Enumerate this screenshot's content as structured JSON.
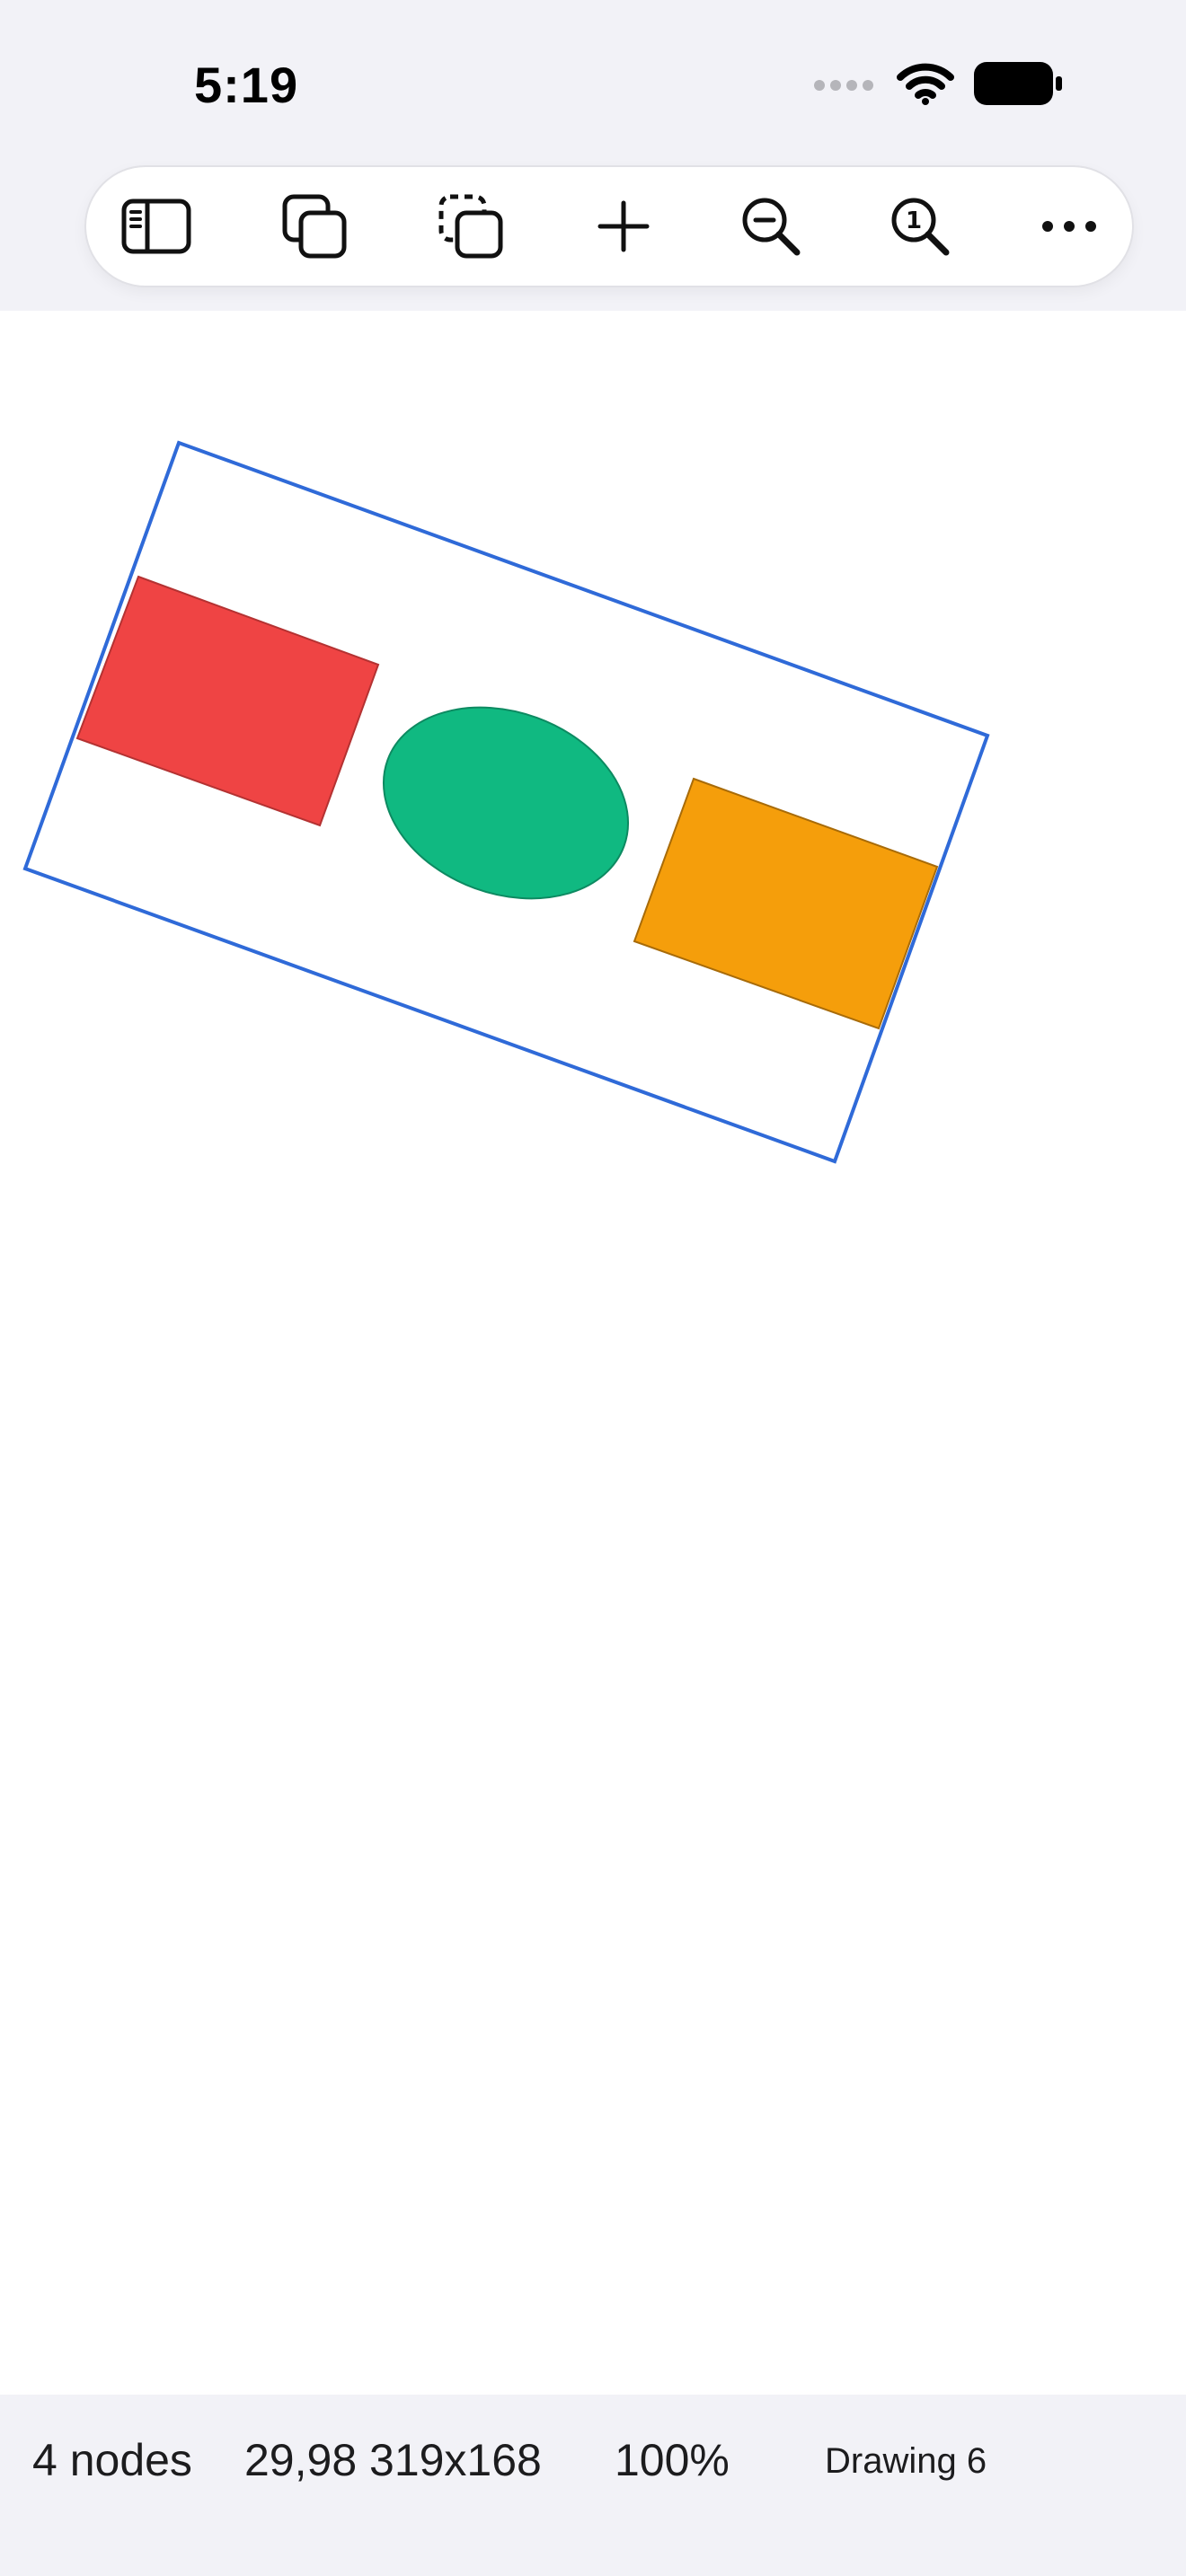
{
  "status_bar": {
    "time": "5:19"
  },
  "toolbar": {
    "buttons": [
      {
        "name": "sidebar-toggle",
        "icon": "sidebar-icon"
      },
      {
        "name": "duplicate",
        "icon": "duplicate-icon"
      },
      {
        "name": "copy-selection",
        "icon": "dashed-copy-icon"
      },
      {
        "name": "add-node",
        "icon": "plus-icon"
      },
      {
        "name": "zoom-out",
        "icon": "zoom-out-icon"
      },
      {
        "name": "zoom-actual-size",
        "icon": "zoom-one-icon",
        "glyph": "1"
      },
      {
        "name": "more",
        "icon": "ellipsis-icon"
      }
    ]
  },
  "canvas": {
    "selection_color": "#2f6ad8",
    "shapes": [
      {
        "kind": "rectangle",
        "fill": "#ef4444"
      },
      {
        "kind": "ellipse",
        "fill": "#10b981"
      },
      {
        "kind": "rectangle",
        "fill": "#f59e0b"
      }
    ]
  },
  "footer": {
    "node_count": "4 nodes",
    "position_size": "29,98 319x168",
    "zoom": "100%",
    "document_name": "Drawing 6"
  }
}
